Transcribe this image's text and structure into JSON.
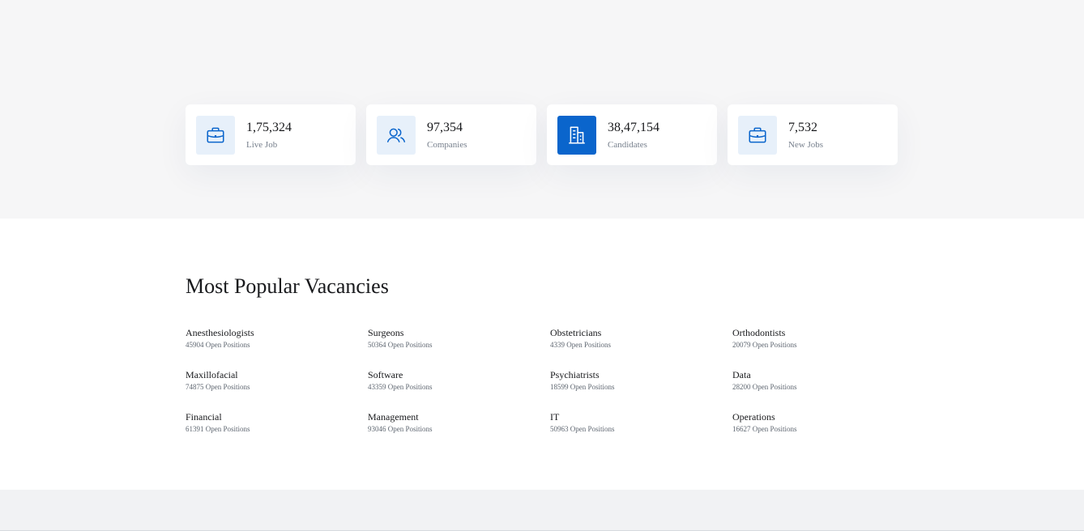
{
  "stats": [
    {
      "icon": "briefcase-icon",
      "value": "1,75,324",
      "label": "Live Job",
      "active": false
    },
    {
      "icon": "users-icon",
      "value": "97,354",
      "label": "Companies",
      "active": false
    },
    {
      "icon": "buildings-icon",
      "value": "38,47,154",
      "label": "Candidates",
      "active": true
    },
    {
      "icon": "briefcase-icon",
      "value": "7,532",
      "label": "New Jobs",
      "active": false
    }
  ],
  "vacancies": {
    "title": "Most Popular Vacancies",
    "items": [
      {
        "name": "Anesthesiologists",
        "count": "45904 Open Positions"
      },
      {
        "name": "Surgeons",
        "count": "50364 Open Positions"
      },
      {
        "name": "Obstetricians",
        "count": "4339 Open Positions"
      },
      {
        "name": "Orthodontists",
        "count": "20079 Open Positions"
      },
      {
        "name": "Maxillofacial",
        "count": "74875 Open Positions"
      },
      {
        "name": "Software",
        "count": "43359 Open Positions"
      },
      {
        "name": "Psychiatrists",
        "count": "18599 Open Positions"
      },
      {
        "name": "Data",
        "count": "28200 Open Positions"
      },
      {
        "name": "Financial",
        "count": "61391 Open Positions"
      },
      {
        "name": "Management",
        "count": "93046 Open Positions"
      },
      {
        "name": "IT",
        "count": "50963 Open Positions"
      },
      {
        "name": "Operations",
        "count": "16627 Open Positions"
      }
    ]
  },
  "colors": {
    "primary": "#0a65cc",
    "icon_bg": "#e7f0fa",
    "section_bg": "#f6f6f7"
  }
}
